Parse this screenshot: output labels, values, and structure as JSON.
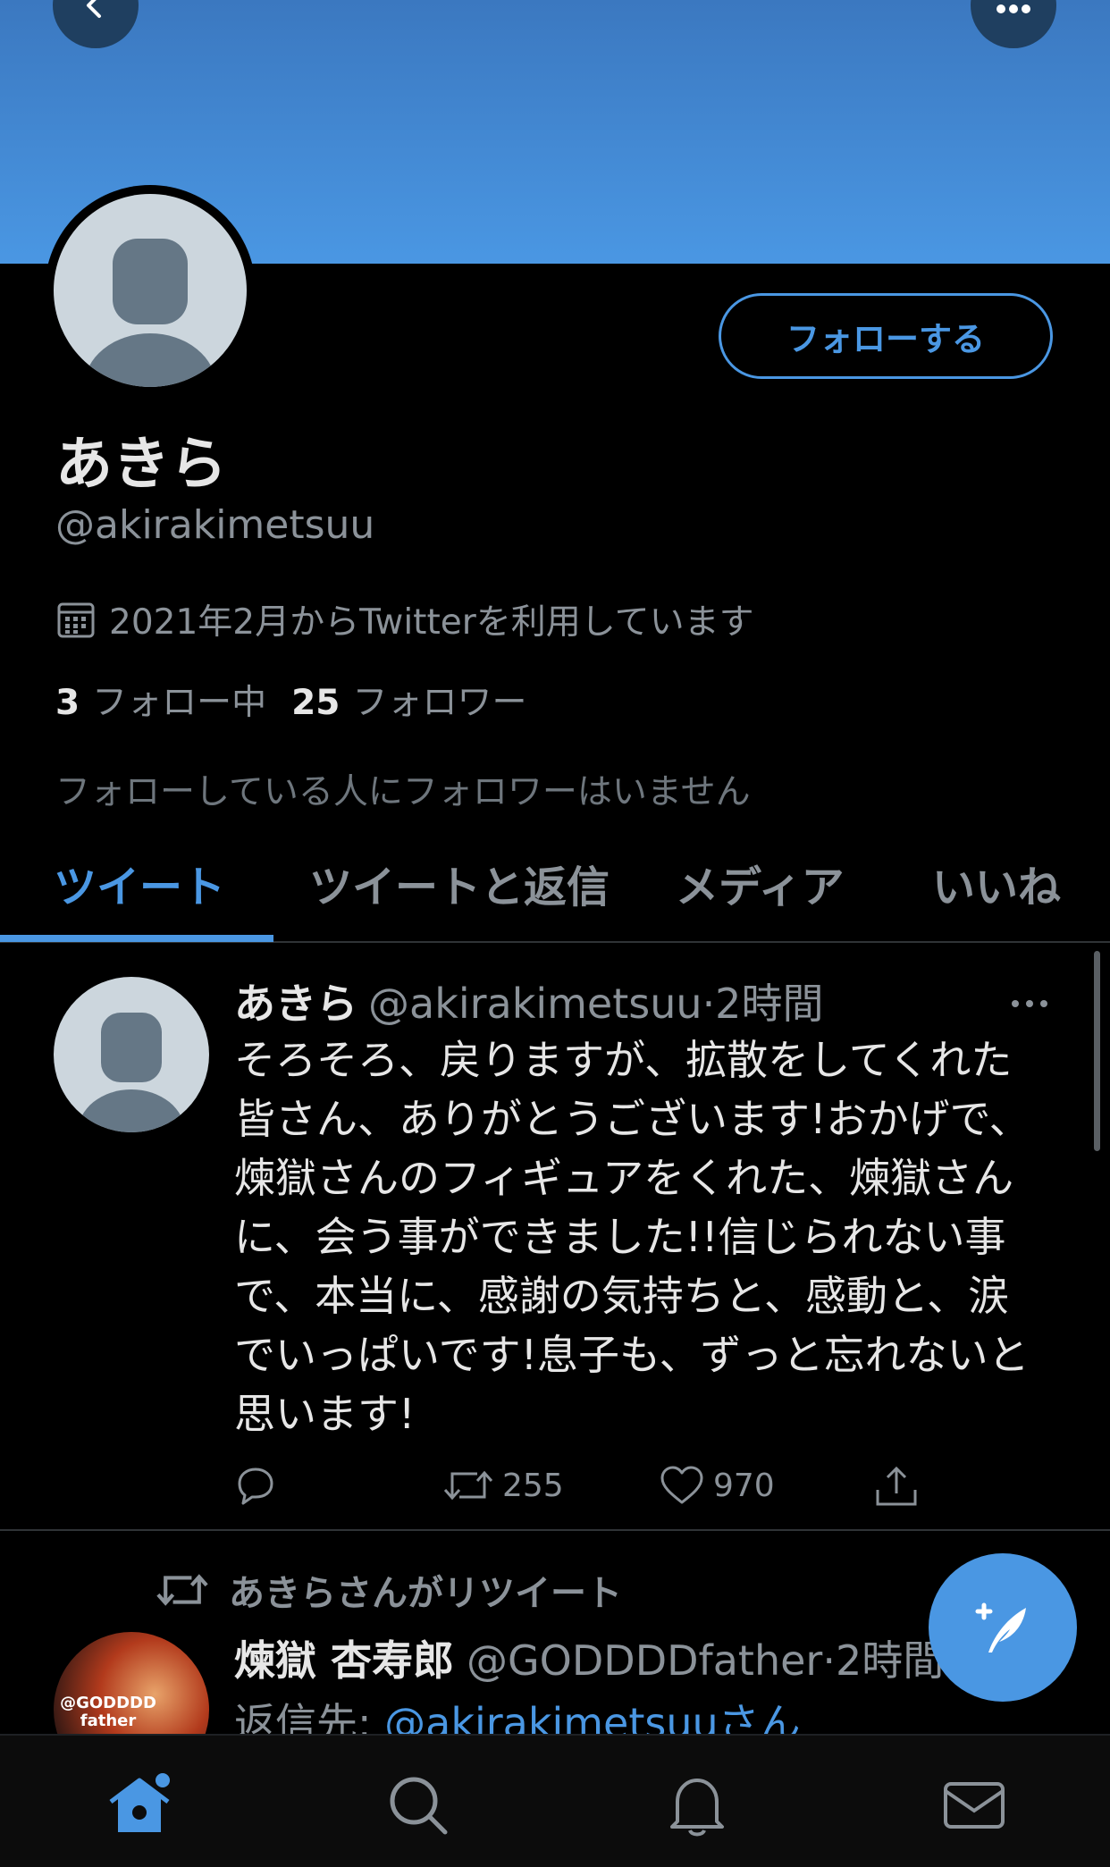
{
  "header": {
    "back_icon": "chevron-left-icon",
    "more_icon": "more-horizontal-icon",
    "banner_color": "#4a97e3"
  },
  "profile": {
    "display_name": "あきら",
    "handle": "@akirakimetsuu",
    "joined": "2021年2月からTwitterを利用しています",
    "following_count": "3",
    "following_label": "フォロー中",
    "followers_count": "25",
    "followers_label": "フォロワー",
    "notice": "フォローしている人にフォロワーはいません",
    "follow_button": "フォローする"
  },
  "tabs": [
    {
      "label": "ツイート",
      "active": true
    },
    {
      "label": "ツイートと返信",
      "active": false
    },
    {
      "label": "メディア",
      "active": false
    },
    {
      "label": "いいね",
      "active": false
    }
  ],
  "tweet": {
    "name": "あきら",
    "handle": "@akirakimetsuu",
    "time": "·2時間",
    "lines": [
      "そろそろ、戻りますが、拡散をしてくれた",
      "皆さん、ありがとうございます!おかげで、",
      "煉獄さんのフィギュアをくれた、煉獄さん",
      "に、会う事ができました!!信じられない事",
      "で、本当に、感謝の気持ちと、感動と、涙",
      "でいっぱいです!息子も、ずっと忘れないと",
      "思います!"
    ],
    "retweets": "255",
    "likes": "970"
  },
  "retweet_item": {
    "label": "あきらさんがリツイート",
    "name": "煉獄 杏寿郎",
    "handle": "@GODDDDfather",
    "time": "·2時間",
    "reply_prefix": "返信先: ",
    "reply_link": "@akirakimetsuuさん",
    "avatar_text": "@GODDDD father"
  },
  "accent_color": "#4a97e3"
}
